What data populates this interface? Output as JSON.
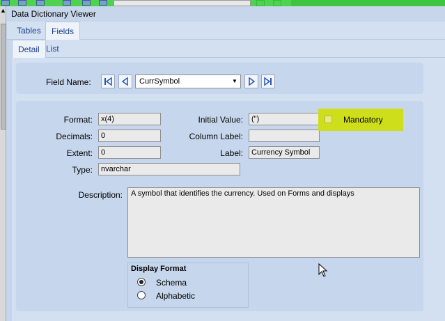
{
  "window": {
    "title": "Data Dictionary Viewer"
  },
  "tabs_main": [
    {
      "label": "Tables"
    },
    {
      "label": "Fields",
      "active": true
    }
  ],
  "tabs_sub": [
    {
      "label": "Detail",
      "active": true
    },
    {
      "label": "List"
    }
  ],
  "field_name": {
    "label": "Field Name:",
    "value": "CurrSymbol",
    "nav": [
      "first-icon",
      "prev-icon",
      "next-icon",
      "last-icon"
    ]
  },
  "details": {
    "format_label": "Format:",
    "format_value": "x(4)",
    "decimals_label": "Decimals:",
    "decimals_value": "0",
    "extent_label": "Extent:",
    "extent_value": "0",
    "type_label": "Type:",
    "type_value": "nvarchar",
    "initial_label": "Initial Value:",
    "initial_value": "(\")",
    "column_label_label": "Column Label:",
    "column_label_value": "",
    "label_label": "Label:",
    "label_value": "Currency Symbol",
    "mandatory_label": "Mandatory",
    "mandatory_checked": false,
    "description_label": "Description:",
    "description_value": "A symbol that identifies the currency. Used on Forms and displays"
  },
  "display_format": {
    "title": "Display Format",
    "options": [
      {
        "label": "Schema",
        "selected": true
      },
      {
        "label": "Alphabetic",
        "selected": false
      }
    ]
  },
  "colors": {
    "highlight": "#cfde1a",
    "toolbar": "#4fd24f",
    "panel": "#c6d6ec",
    "tab_text": "#1a3f8a"
  }
}
